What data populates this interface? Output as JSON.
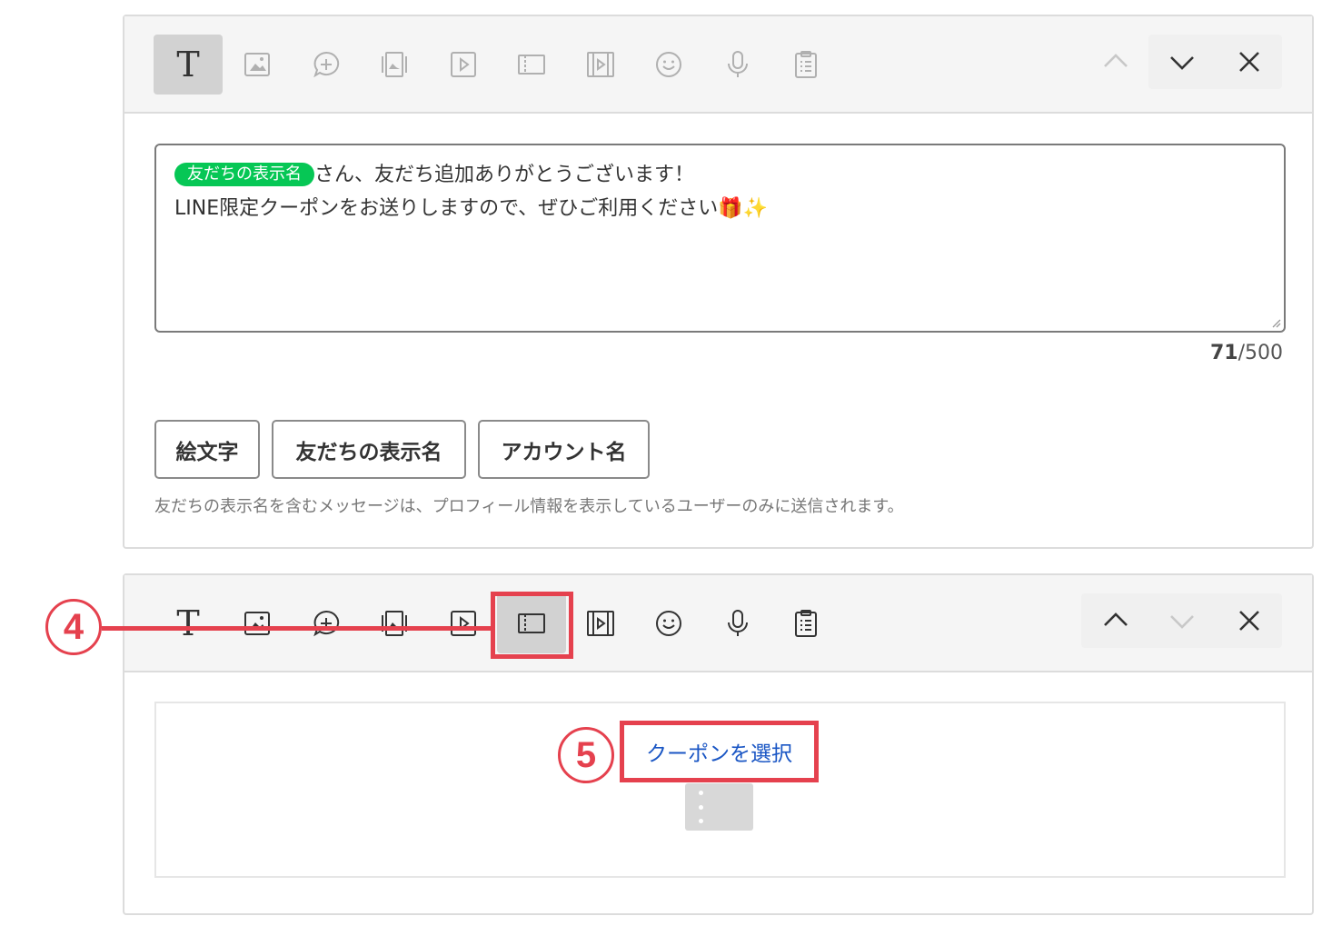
{
  "colors": {
    "accent_red": "#e5414e",
    "line_green": "#06c755",
    "link_blue": "#1a56c4"
  },
  "panel1": {
    "toolbar_tools": [
      "text-icon",
      "image-icon",
      "stamp-icon",
      "image-carousel-icon",
      "video-icon",
      "coupon-icon",
      "rich-video-icon",
      "emoji-icon",
      "voice-icon",
      "survey-icon"
    ],
    "text_tool_glyph": "T",
    "message": {
      "friend_name_tag": "友だちの表示名",
      "line1_rest": "さん、友だち追加ありがとうございます！",
      "line2": "LINE限定クーポンをお送りしますので、ぜひご利用ください🎁✨"
    },
    "counter_current": "71",
    "counter_max": "/500",
    "chips": [
      "絵文字",
      "友だちの表示名",
      "アカウント名"
    ],
    "note": "友だちの表示名を含むメッセージは、プロフィール情報を表示しているユーザーのみに送信されます。"
  },
  "panel2": {
    "text_tool_glyph": "T",
    "select_coupon_label": "クーポンを選択"
  },
  "callouts": {
    "step4": "4",
    "step5": "5"
  }
}
